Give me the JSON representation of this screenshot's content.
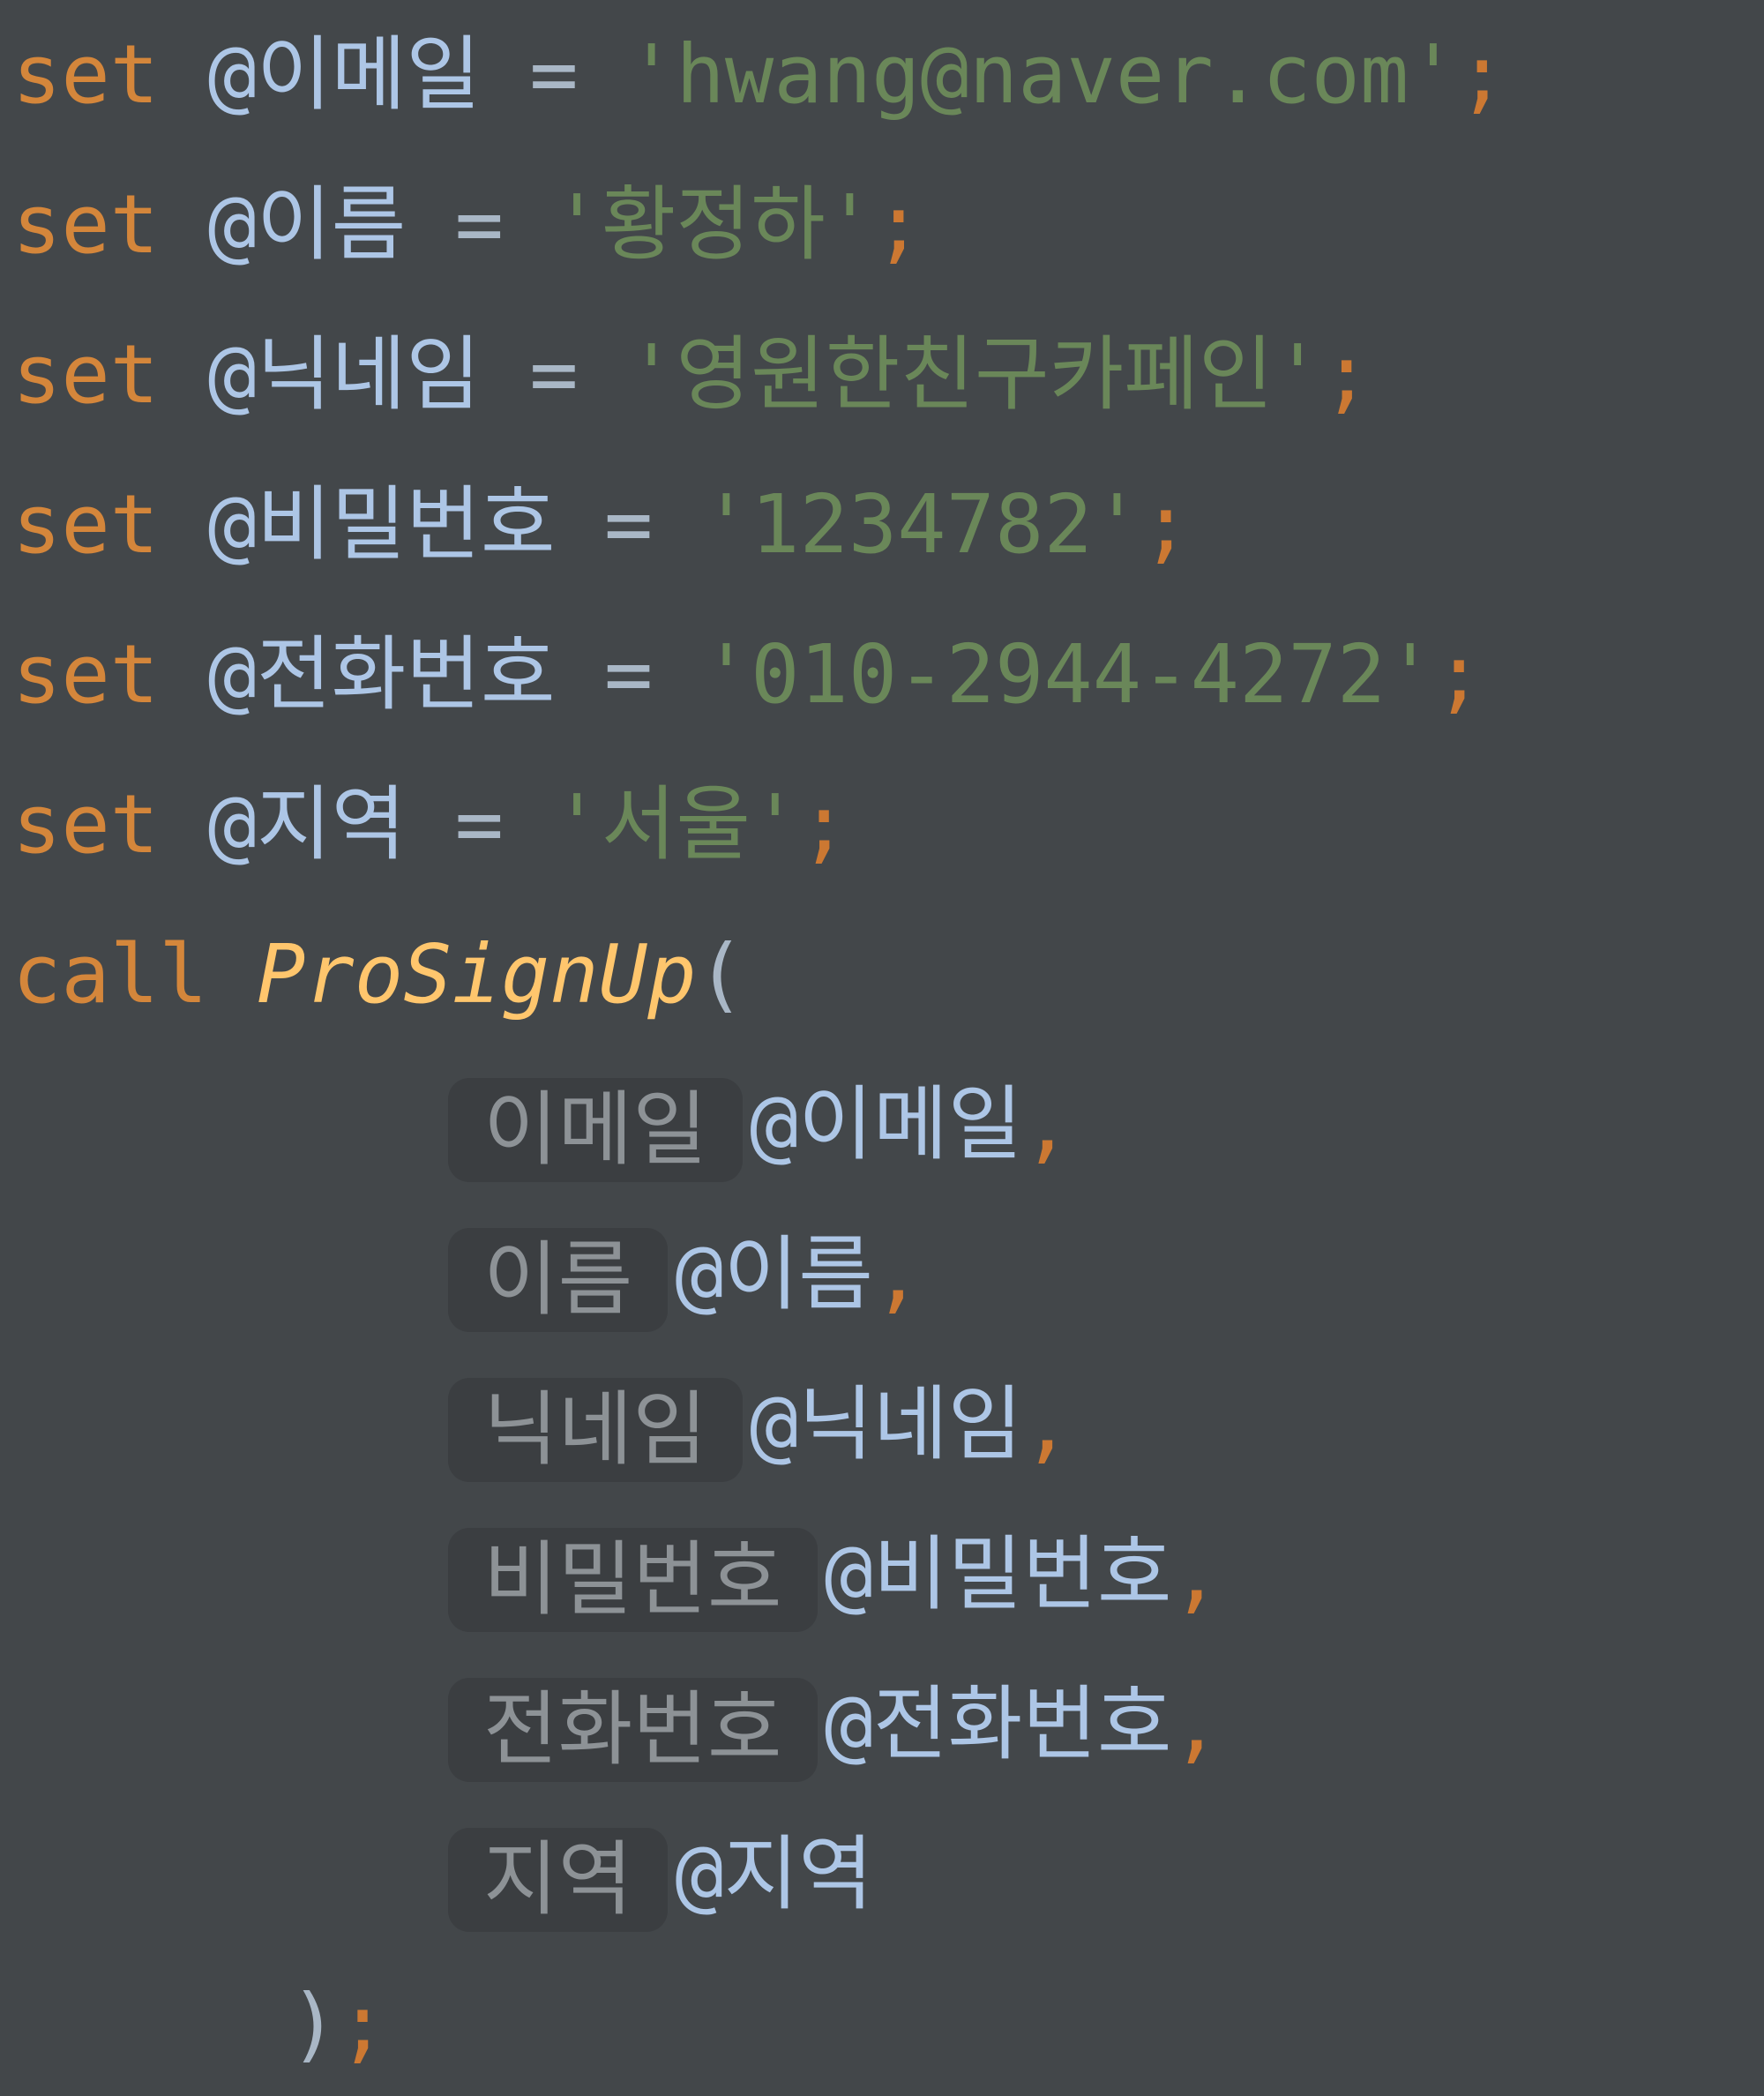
{
  "code": {
    "set_lines": [
      {
        "keyword": "set",
        "var": "@이메일",
        "op": "=",
        "value": "'hwang@naver.com'",
        "end": ";"
      },
      {
        "keyword": "set",
        "var": "@이름",
        "op": "=",
        "value": "'황정하'",
        "end": ";"
      },
      {
        "keyword": "set",
        "var": "@닉네임",
        "op": "=",
        "value": "'영원한친구카페인'",
        "end": ";"
      },
      {
        "keyword": "set",
        "var": "@비밀번호",
        "op": "=",
        "value": "'1234782'",
        "end": ";"
      },
      {
        "keyword": "set",
        "var": "@전화번호",
        "op": "=",
        "value": "'010-2944-4272'",
        "end": ";"
      },
      {
        "keyword": "set",
        "var": "@지역",
        "op": "=",
        "value": "'서울'",
        "end": ";"
      }
    ],
    "call": {
      "keyword": "call",
      "name": "ProSignUp",
      "open": "("
    },
    "args": [
      {
        "hint": "이메일",
        "var": "@이메일",
        "sep": ","
      },
      {
        "hint": "이름",
        "var": "@이름",
        "sep": ","
      },
      {
        "hint": "닉네임",
        "var": "@닉네임",
        "sep": ","
      },
      {
        "hint": "비밀번호",
        "var": "@비밀번호",
        "sep": ","
      },
      {
        "hint": "전화번호",
        "var": "@전화번호",
        "sep": ","
      },
      {
        "hint": "지역",
        "var": "@지역",
        "sep": ""
      }
    ],
    "close": {
      "paren": ")",
      "end": ";"
    }
  },
  "colors": {
    "background": "#43474a",
    "keyword": "#d4863b",
    "variable": "#adc6e6",
    "string": "#6a8759",
    "function": "#ffc66d",
    "hint_bg": "#3b3e41",
    "hint_text": "#8d9296"
  }
}
